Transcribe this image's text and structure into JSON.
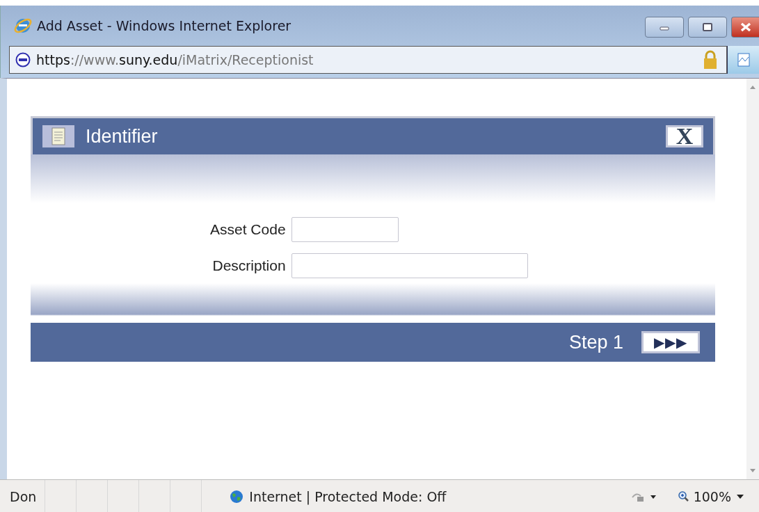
{
  "window": {
    "title": "Add Asset - Windows Internet Explorer"
  },
  "address_bar": {
    "url_parts": [
      {
        "text": "https",
        "strong": true
      },
      {
        "text": "://www.",
        "strong": false
      },
      {
        "text": "suny.edu",
        "strong": true
      },
      {
        "text": "/iMatrix/Receptionist",
        "strong": false
      }
    ]
  },
  "dialog": {
    "title": "Identifier",
    "close_label": "X",
    "fields": [
      {
        "label": "Asset Code"
      },
      {
        "label": "Description"
      }
    ],
    "footer": {
      "step": "Step 1",
      "next_label": "▶▶▶"
    }
  },
  "status_bar": {
    "status": "Don",
    "zone": "Internet | Protected Mode: Off",
    "zoom": "100%"
  }
}
